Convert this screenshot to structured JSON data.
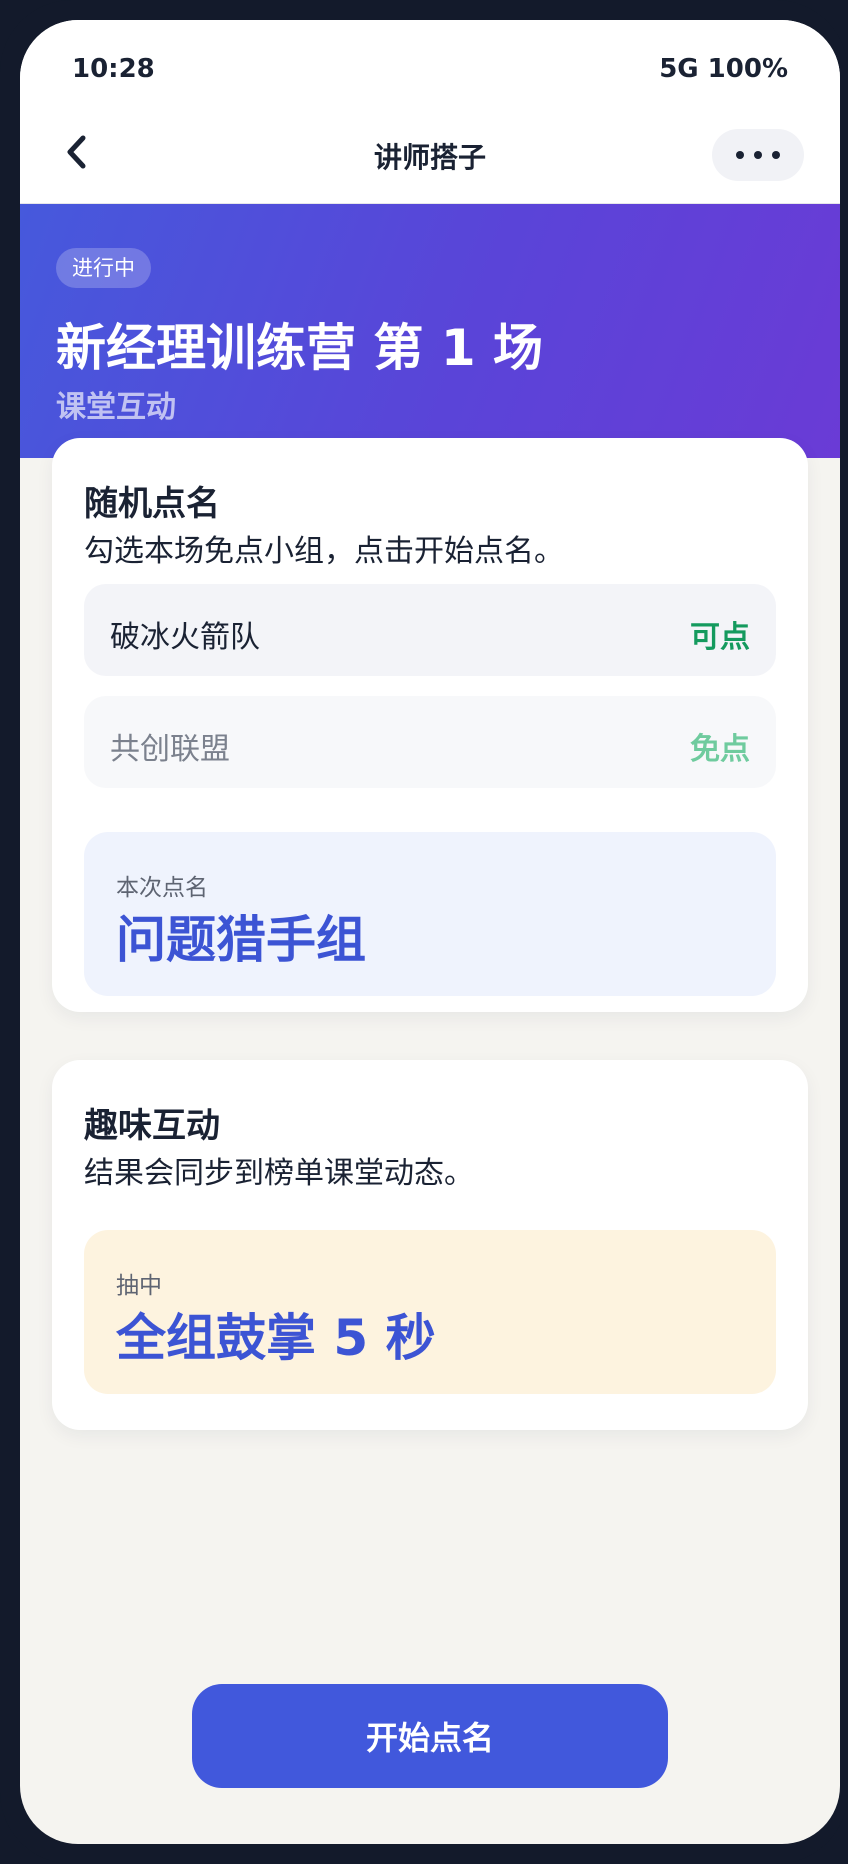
{
  "status_bar": {
    "time": "10:28",
    "network_battery": "5G 100%"
  },
  "nav": {
    "title": "讲师搭子",
    "back_icon": "chevron-left-icon",
    "more_icon": "more-dots-icon"
  },
  "hero": {
    "badge": "进行中",
    "title": "新经理训练营 第 1 场",
    "subtitle": "课堂互动"
  },
  "roll_call": {
    "title": "随机点名",
    "description": "勾选本场免点小组，点击开始点名。",
    "groups": [
      {
        "name": "破冰火箭队",
        "status": "可点"
      },
      {
        "name": "共创联盟",
        "status": "免点"
      }
    ],
    "result": {
      "label": "本次点名",
      "value": "问题猎手组"
    }
  },
  "fun": {
    "title": "趣味互动",
    "description": "结果会同步到榜单课堂动态。",
    "result": {
      "label": "抽中",
      "value": "全组鼓掌 5 秒"
    }
  },
  "footer": {
    "start_label": "开始点名"
  },
  "colors": {
    "accent": "#4158dc",
    "hero_gradient_start": "#4659dc",
    "hero_gradient_end": "#6a3bd6",
    "status_available": "#149a5e",
    "status_exempt": "#6fcb9e"
  }
}
